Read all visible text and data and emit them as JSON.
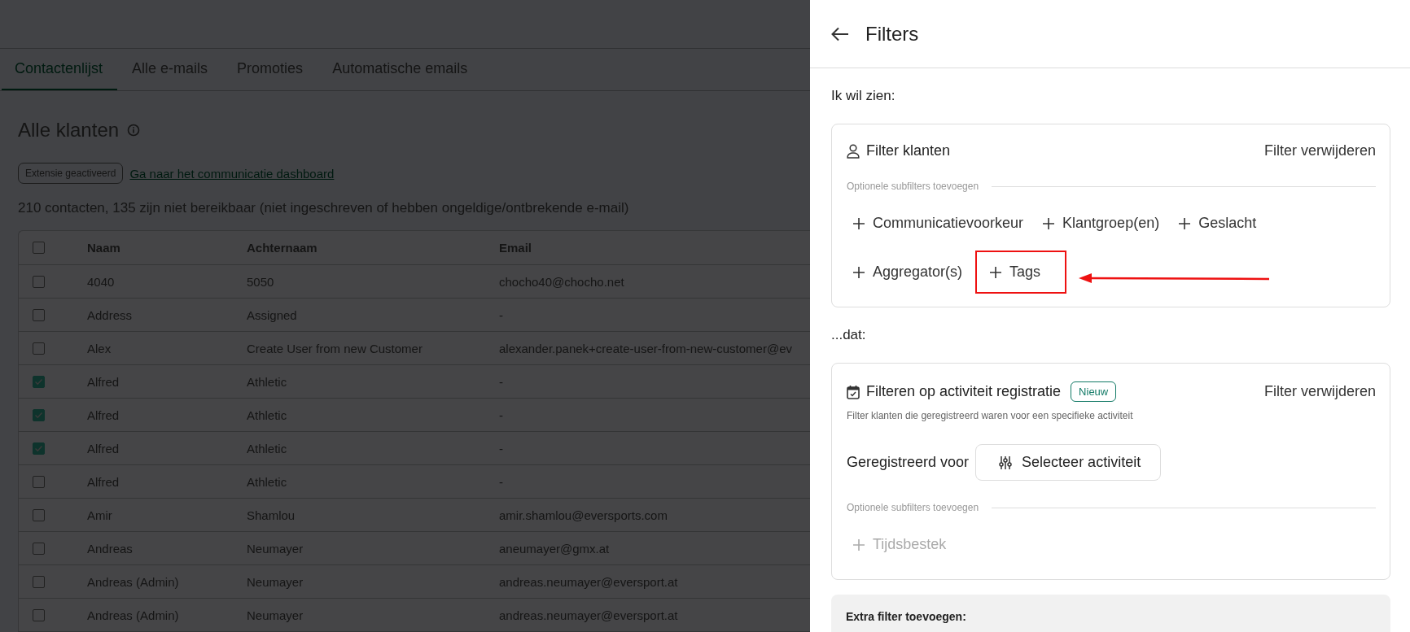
{
  "top_tabs": [
    {
      "label": "Contactenlijst",
      "selected": true
    },
    {
      "label": "Alle e-mails",
      "selected": false
    },
    {
      "label": "Promoties",
      "selected": false
    },
    {
      "label": "Automatische emails",
      "selected": false
    }
  ],
  "page": {
    "title": "Alle klanten",
    "badge": "Extensie geactiveerd",
    "link": "Ga naar het communicatie dashboard",
    "summary": "210 contacten, 135 zijn niet bereikbaar (niet ingeschreven of hebben ongeldige/ontbrekende e-mail)"
  },
  "table": {
    "columns": [
      "Naam",
      "Achternaam",
      "Email"
    ],
    "header_checked": false,
    "rows": [
      {
        "checked": false,
        "cells": [
          "4040",
          "5050",
          "chocho40@chocho.net"
        ]
      },
      {
        "checked": false,
        "cells": [
          "Address",
          "Assigned",
          "-"
        ]
      },
      {
        "checked": false,
        "cells": [
          "Alex",
          "Create User from new Customer",
          "alexander.panek+create-user-from-new-customer@ev"
        ]
      },
      {
        "checked": true,
        "cells": [
          "Alfred",
          "Athletic",
          "-"
        ]
      },
      {
        "checked": true,
        "cells": [
          "Alfred",
          "Athletic",
          "-"
        ]
      },
      {
        "checked": true,
        "cells": [
          "Alfred",
          "Athletic",
          "-"
        ]
      },
      {
        "checked": false,
        "cells": [
          "Alfred",
          "Athletic",
          "-"
        ]
      },
      {
        "checked": false,
        "cells": [
          "Amir",
          "Shamlou",
          "amir.shamlou@eversports.com"
        ]
      },
      {
        "checked": false,
        "cells": [
          "Andreas",
          "Neumayer",
          "aneumayer@gmx.at"
        ]
      },
      {
        "checked": false,
        "cells": [
          "Andreas (Admin)",
          "Neumayer",
          "andreas.neumayer@eversport.at"
        ]
      },
      {
        "checked": false,
        "cells": [
          "Andreas (Admin)",
          "Neumayer",
          "andreas.neumayer@eversport.at"
        ]
      }
    ]
  },
  "filter_panel": {
    "title": "Filters",
    "sections": [
      {
        "heading": "Ik wil zien:",
        "card": {
          "kind": "customers",
          "title": "Filter klanten",
          "remove": "Filter verwijderen",
          "subfilter_label": "Optionele subfilters toevoegen",
          "subfilters": [
            {
              "label": "Communicatievoorkeur",
              "disabled": false,
              "highlighted": false
            },
            {
              "label": "Klantgroep(en)",
              "disabled": false,
              "highlighted": false
            },
            {
              "label": "Geslacht",
              "disabled": false,
              "highlighted": false
            },
            {
              "label": "Aggregator(s)",
              "disabled": false,
              "highlighted": false
            },
            {
              "label": "Tags",
              "disabled": false,
              "highlighted": true
            }
          ]
        }
      },
      {
        "heading": "...dat:",
        "card": {
          "kind": "activity",
          "title": "Filteren op activiteit registratie",
          "badge": "Nieuw",
          "remove": "Filter verwijderen",
          "description": "Filter klanten die geregistreerd waren voor een specifieke activiteit",
          "field_label": "Geregistreerd voor",
          "select_button": "Selecteer activiteit",
          "subfilter_label": "Optionele subfilters toevoegen",
          "subfilters": [
            {
              "label": "Tijdsbestek",
              "disabled": true,
              "highlighted": false
            }
          ]
        }
      }
    ],
    "extra": {
      "title": "Extra filter toevoegen:"
    }
  }
}
